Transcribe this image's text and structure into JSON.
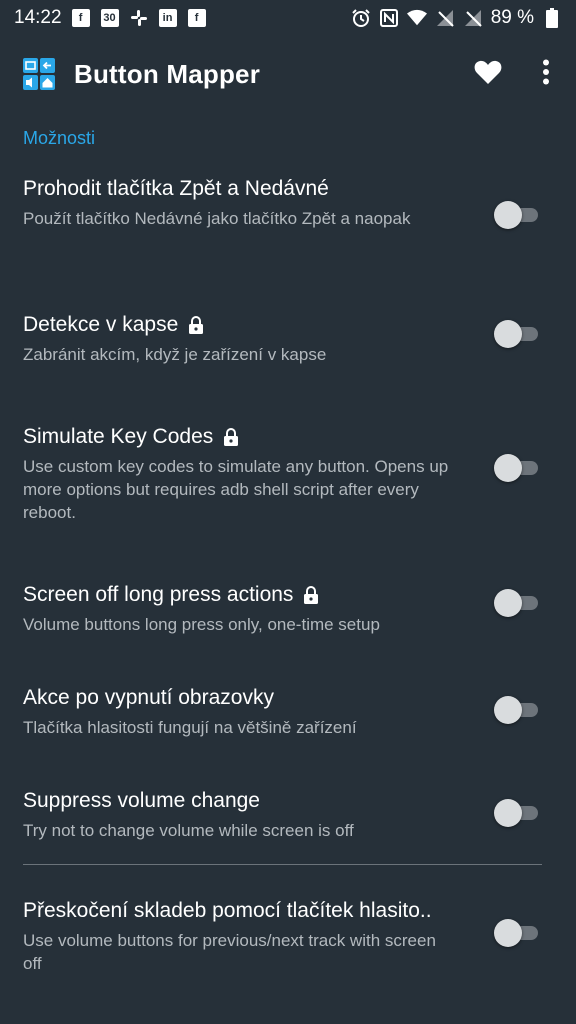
{
  "status_bar": {
    "time": "14:22",
    "battery_percent": "89 %",
    "left_icons": [
      "facebook-icon",
      "calendar-icon",
      "slack-icon",
      "linkedin-icon",
      "facebook-icon"
    ],
    "calendar_day": "30",
    "right_icons": [
      "alarm-icon",
      "nfc-icon",
      "wifi-icon",
      "signal-icon",
      "signal-icon"
    ]
  },
  "toolbar": {
    "title": "Button Mapper",
    "actions": [
      "heart-icon",
      "more-vert-icon"
    ]
  },
  "section": {
    "header": "Možnosti"
  },
  "preferences": [
    {
      "title": "Prohodit tlačítka Zpět a Nedávné",
      "summary": "Použít tlačítko Nedávné jako tlačítko Zpět a naopak",
      "locked": false,
      "enabled": false
    },
    {
      "title": "Detekce v kapse",
      "summary": "Zabránit akcím, když je zařízení v kapse",
      "locked": true,
      "enabled": false
    },
    {
      "title": "Simulate Key Codes",
      "summary": "Use custom key codes to simulate any button. Opens up more options but requires adb shell script after every reboot.",
      "locked": true,
      "enabled": false
    },
    {
      "title": "Screen off long press actions",
      "summary": "Volume buttons long press only, one-time setup",
      "locked": true,
      "enabled": false
    },
    {
      "title": "Akce po vypnutí obrazovky",
      "summary": "Tlačítka hlasitosti fungují na většině zařízení",
      "locked": false,
      "enabled": false
    },
    {
      "title": "Suppress volume change",
      "summary": "Try not to change volume while screen is off",
      "locked": false,
      "enabled": false
    },
    {
      "title": "Přeskočení skladeb pomocí tlačítek hlasito..",
      "summary": "Use volume buttons for previous/next track with screen off",
      "locked": false,
      "enabled": false
    }
  ],
  "colors": {
    "background": "#263039",
    "accent": "#2aa7e8",
    "summary_text": "#b3b9be"
  }
}
